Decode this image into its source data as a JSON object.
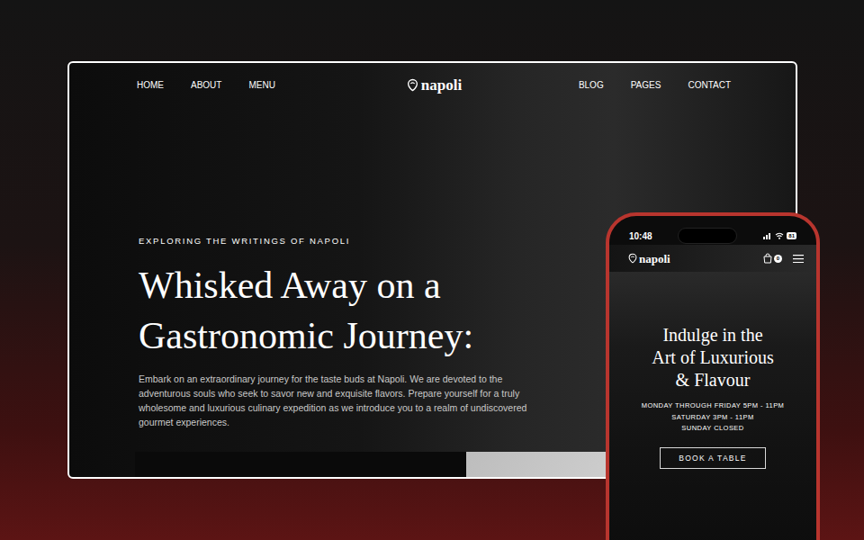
{
  "desktop": {
    "nav_left": [
      "HOME",
      "ABOUT",
      "MENU"
    ],
    "logo": "napoli",
    "nav_right": [
      "BLOG",
      "PAGES",
      "CONTACT"
    ],
    "eyebrow": "EXPLORING THE WRITINGS OF NAPOLI",
    "headline": [
      "Whisked Away on a",
      "Gastronomic Journey:"
    ],
    "body": "Embark on an extraordinary journey for the taste buds at Napoli. We are devoted to the adventurous souls who seek to savor new and exquisite flavors. Prepare yourself for a truly wholesome and luxurious culinary expedition as we introduce you to a realm of undiscovered gourmet experiences."
  },
  "phone": {
    "time": "10:48",
    "battery": "81",
    "logo": "napoli",
    "cart_count": "0",
    "headline": [
      "Indulge in the",
      "Art of Luxurious",
      "& Flavour"
    ],
    "hours": [
      "MONDAY THROUGH FRIDAY 5PM - 11PM",
      "SATURDAY 3PM - 11PM",
      "SUNDAY CLOSED"
    ],
    "button": "BOOK A TABLE"
  }
}
